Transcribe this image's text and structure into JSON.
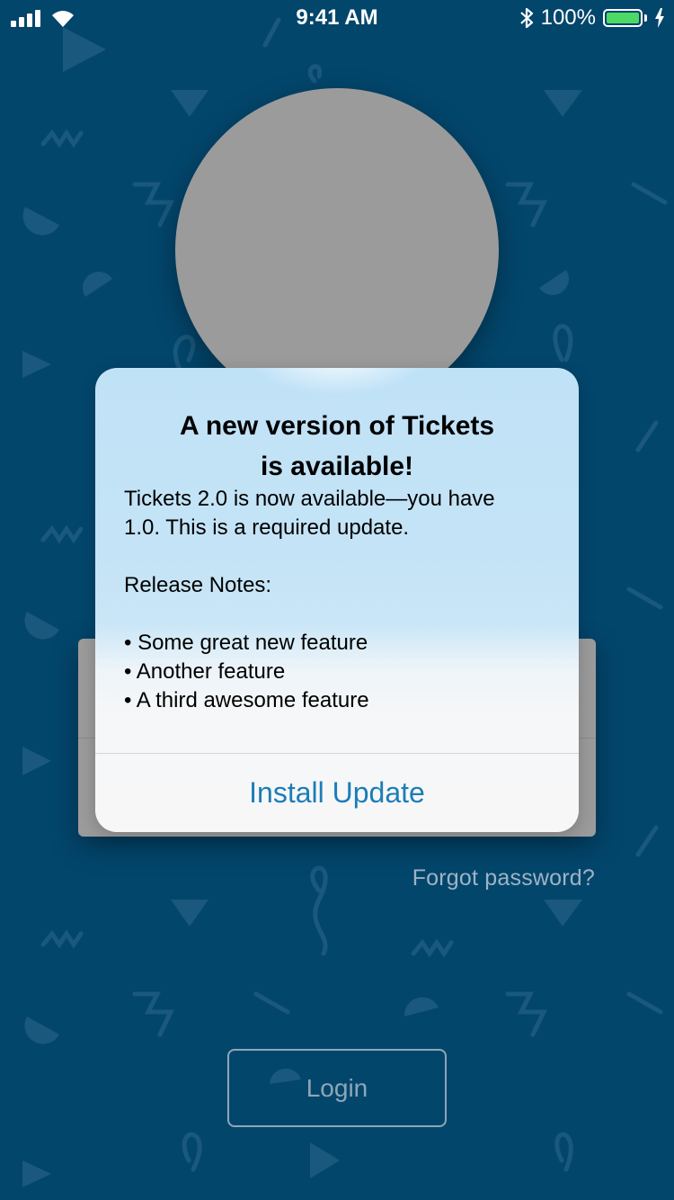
{
  "status_bar": {
    "time": "9:41 AM",
    "battery_percent": "100%",
    "battery_level": 1.0,
    "signal_icon": "cellular-signal-icon",
    "wifi_icon": "wifi-icon",
    "bluetooth_icon": "bluetooth-icon",
    "charging_icon": "charging-bolt-icon",
    "battery_color": "#4cd964"
  },
  "login": {
    "forgot_password": "Forgot password?",
    "login_button": "Login"
  },
  "alert": {
    "title_line1": "A new version of Tickets",
    "title_line2": "is available!",
    "message_line1": "Tickets 2.0 is now available—you have",
    "message_line2": "1.0. This is a required update.",
    "notes_heading": "Release Notes:",
    "notes": [
      "Some great new feature",
      "Another feature",
      "A third awesome feature"
    ],
    "action_label": "Install Update",
    "action_color": "#1b7db8"
  },
  "colors": {
    "background": "#03466c",
    "avatar_placeholder": "#9b9b9b"
  }
}
